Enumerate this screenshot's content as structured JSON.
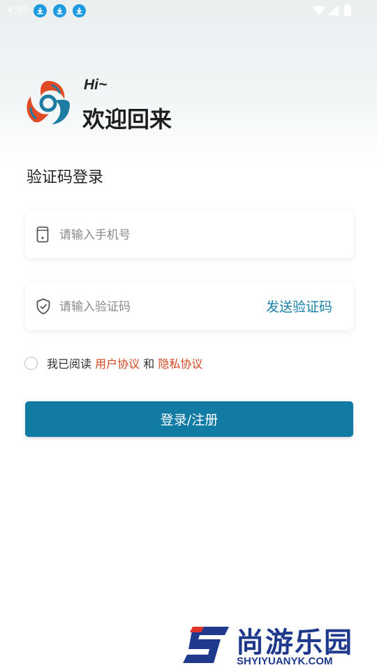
{
  "status_bar": {
    "time": "4:55",
    "notification_icons": [
      "download-icon",
      "download-icon",
      "download-icon"
    ]
  },
  "header": {
    "greeting": "Hi~",
    "title": "欢迎回来"
  },
  "form": {
    "heading": "验证码登录",
    "phone": {
      "placeholder": "请输入手机号",
      "value": ""
    },
    "code": {
      "placeholder": "请输入验证码",
      "value": "",
      "send_label": "发送验证码"
    },
    "agreement": {
      "prefix": "我已阅读",
      "user_agreement": "用户协议",
      "conjunction": "和",
      "privacy_agreement": "隐私协议",
      "checked": false
    },
    "submit_label": "登录/注册"
  },
  "watermark": {
    "chinese": "尚游乐园",
    "english": "SHYIYUANYK.COM"
  },
  "colors": {
    "primary": "#127ba3",
    "link": "#d2461e",
    "send_code": "#1a80a8"
  }
}
